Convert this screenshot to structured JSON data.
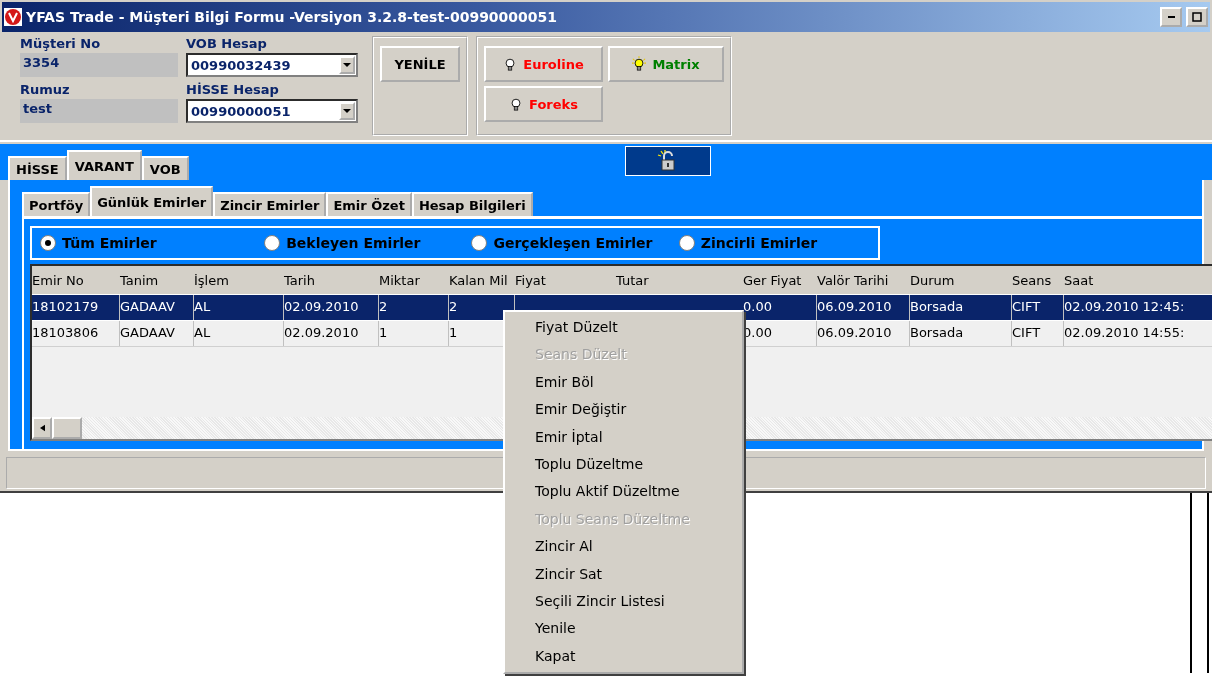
{
  "window": {
    "title": "YFAS Trade - Müşteri Bilgi Formu -Versiyon 3.2.8-test-00990000051"
  },
  "customer": {
    "fields": [
      {
        "label": "Müşteri No",
        "value": "3354"
      },
      {
        "label": "Rumuz",
        "value": "test"
      }
    ],
    "accounts": [
      {
        "label": "VOB Hesap",
        "value": "00990032439"
      },
      {
        "label": "HİSSE Hesap",
        "value": "00990000051"
      }
    ],
    "refresh_button": "YENİLE",
    "connections": [
      {
        "label": "Euroline",
        "lit": false,
        "color": "#ff0000"
      },
      {
        "label": "Matrix",
        "lit": true,
        "color": "#008000"
      },
      {
        "label": "Foreks",
        "lit": false,
        "color": "#ff0000"
      }
    ]
  },
  "tabs": [
    {
      "label": "HİSSE",
      "selected": false
    },
    {
      "label": "VARANT",
      "selected": true
    },
    {
      "label": "VOB",
      "selected": false
    }
  ],
  "subtabs": [
    {
      "label": "Portföy",
      "selected": false
    },
    {
      "label": "Günlük Emirler",
      "selected": true
    },
    {
      "label": "Zincir Emirler",
      "selected": false
    },
    {
      "label": "Emir Özet",
      "selected": false
    },
    {
      "label": "Hesap Bilgileri",
      "selected": false
    }
  ],
  "filters": [
    {
      "label": "Tüm Emirler",
      "selected": true
    },
    {
      "label": "Bekleyen Emirler",
      "selected": false
    },
    {
      "label": "Gerçekleşen Emirler",
      "selected": false
    },
    {
      "label": "Zincirli Emirler",
      "selected": false
    }
  ],
  "table": {
    "columns": [
      "Emir No",
      "Tanim",
      "İşlem",
      "Tarih",
      "Miktar",
      "Kalan Mil",
      "Fiyat",
      "Tutar",
      "Ger Fiyat",
      "Valör Tarihi",
      "Durum",
      "Seans",
      "Saat"
    ],
    "rows": [
      {
        "selected": true,
        "cells": [
          "18102179",
          "GADAAV",
          "AL",
          "02.09.2010",
          "2",
          "2",
          null,
          null,
          "0.00",
          "06.09.2010",
          "Borsada",
          "CIFT",
          "02.09.2010 12:45:"
        ]
      },
      {
        "selected": false,
        "cells": [
          "18103806",
          "GADAAV",
          "AL",
          "02.09.2010",
          "1",
          "1",
          null,
          null,
          "0.00",
          "06.09.2010",
          "Borsada",
          "CIFT",
          "02.09.2010 14:55:"
        ]
      }
    ]
  },
  "context_menu": [
    {
      "label": "Fiyat Düzelt",
      "disabled": false
    },
    {
      "label": "Seans Düzelt",
      "disabled": true
    },
    {
      "label": "Emir Böl",
      "disabled": false
    },
    {
      "label": "Emir Değiştir",
      "disabled": false
    },
    {
      "label": "Emir İptal",
      "disabled": false
    },
    {
      "label": "Toplu Düzeltme",
      "disabled": false
    },
    {
      "label": "Toplu Aktif Düzeltme",
      "disabled": false
    },
    {
      "label": "Toplu Seans Düzeltme",
      "disabled": true
    },
    {
      "label": "Zincir Al",
      "disabled": false
    },
    {
      "label": "Zincir Sat",
      "disabled": false
    },
    {
      "label": "Seçili Zincir Listesi",
      "disabled": false
    },
    {
      "label": "Yenile",
      "disabled": false
    },
    {
      "label": "Kapat",
      "disabled": false
    }
  ]
}
